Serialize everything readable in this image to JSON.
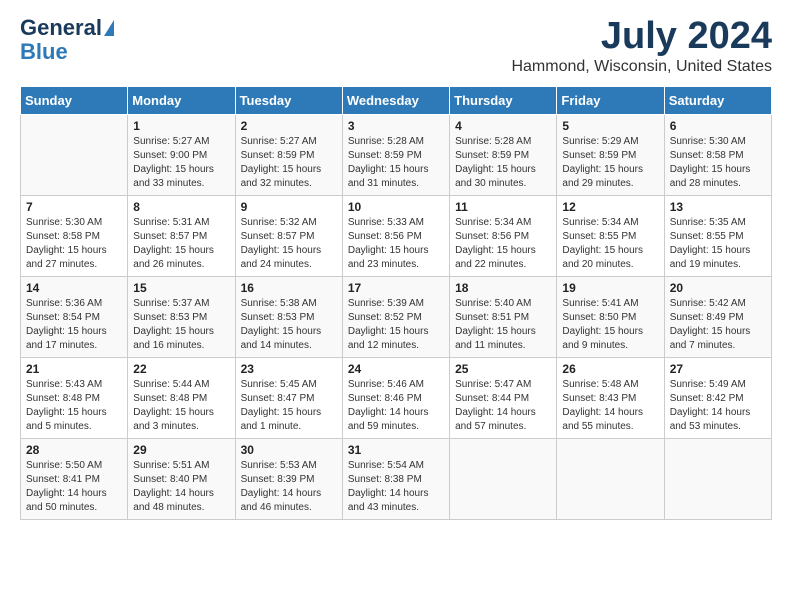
{
  "logo": {
    "line1": "General",
    "line2": "Blue"
  },
  "header": {
    "month_year": "July 2024",
    "location": "Hammond, Wisconsin, United States"
  },
  "days_of_week": [
    "Sunday",
    "Monday",
    "Tuesday",
    "Wednesday",
    "Thursday",
    "Friday",
    "Saturday"
  ],
  "weeks": [
    [
      {
        "day": "",
        "info": ""
      },
      {
        "day": "1",
        "info": "Sunrise: 5:27 AM\nSunset: 9:00 PM\nDaylight: 15 hours\nand 33 minutes."
      },
      {
        "day": "2",
        "info": "Sunrise: 5:27 AM\nSunset: 8:59 PM\nDaylight: 15 hours\nand 32 minutes."
      },
      {
        "day": "3",
        "info": "Sunrise: 5:28 AM\nSunset: 8:59 PM\nDaylight: 15 hours\nand 31 minutes."
      },
      {
        "day": "4",
        "info": "Sunrise: 5:28 AM\nSunset: 8:59 PM\nDaylight: 15 hours\nand 30 minutes."
      },
      {
        "day": "5",
        "info": "Sunrise: 5:29 AM\nSunset: 8:59 PM\nDaylight: 15 hours\nand 29 minutes."
      },
      {
        "day": "6",
        "info": "Sunrise: 5:30 AM\nSunset: 8:58 PM\nDaylight: 15 hours\nand 28 minutes."
      }
    ],
    [
      {
        "day": "7",
        "info": "Sunrise: 5:30 AM\nSunset: 8:58 PM\nDaylight: 15 hours\nand 27 minutes."
      },
      {
        "day": "8",
        "info": "Sunrise: 5:31 AM\nSunset: 8:57 PM\nDaylight: 15 hours\nand 26 minutes."
      },
      {
        "day": "9",
        "info": "Sunrise: 5:32 AM\nSunset: 8:57 PM\nDaylight: 15 hours\nand 24 minutes."
      },
      {
        "day": "10",
        "info": "Sunrise: 5:33 AM\nSunset: 8:56 PM\nDaylight: 15 hours\nand 23 minutes."
      },
      {
        "day": "11",
        "info": "Sunrise: 5:34 AM\nSunset: 8:56 PM\nDaylight: 15 hours\nand 22 minutes."
      },
      {
        "day": "12",
        "info": "Sunrise: 5:34 AM\nSunset: 8:55 PM\nDaylight: 15 hours\nand 20 minutes."
      },
      {
        "day": "13",
        "info": "Sunrise: 5:35 AM\nSunset: 8:55 PM\nDaylight: 15 hours\nand 19 minutes."
      }
    ],
    [
      {
        "day": "14",
        "info": "Sunrise: 5:36 AM\nSunset: 8:54 PM\nDaylight: 15 hours\nand 17 minutes."
      },
      {
        "day": "15",
        "info": "Sunrise: 5:37 AM\nSunset: 8:53 PM\nDaylight: 15 hours\nand 16 minutes."
      },
      {
        "day": "16",
        "info": "Sunrise: 5:38 AM\nSunset: 8:53 PM\nDaylight: 15 hours\nand 14 minutes."
      },
      {
        "day": "17",
        "info": "Sunrise: 5:39 AM\nSunset: 8:52 PM\nDaylight: 15 hours\nand 12 minutes."
      },
      {
        "day": "18",
        "info": "Sunrise: 5:40 AM\nSunset: 8:51 PM\nDaylight: 15 hours\nand 11 minutes."
      },
      {
        "day": "19",
        "info": "Sunrise: 5:41 AM\nSunset: 8:50 PM\nDaylight: 15 hours\nand 9 minutes."
      },
      {
        "day": "20",
        "info": "Sunrise: 5:42 AM\nSunset: 8:49 PM\nDaylight: 15 hours\nand 7 minutes."
      }
    ],
    [
      {
        "day": "21",
        "info": "Sunrise: 5:43 AM\nSunset: 8:48 PM\nDaylight: 15 hours\nand 5 minutes."
      },
      {
        "day": "22",
        "info": "Sunrise: 5:44 AM\nSunset: 8:48 PM\nDaylight: 15 hours\nand 3 minutes."
      },
      {
        "day": "23",
        "info": "Sunrise: 5:45 AM\nSunset: 8:47 PM\nDaylight: 15 hours\nand 1 minute."
      },
      {
        "day": "24",
        "info": "Sunrise: 5:46 AM\nSunset: 8:46 PM\nDaylight: 14 hours\nand 59 minutes."
      },
      {
        "day": "25",
        "info": "Sunrise: 5:47 AM\nSunset: 8:44 PM\nDaylight: 14 hours\nand 57 minutes."
      },
      {
        "day": "26",
        "info": "Sunrise: 5:48 AM\nSunset: 8:43 PM\nDaylight: 14 hours\nand 55 minutes."
      },
      {
        "day": "27",
        "info": "Sunrise: 5:49 AM\nSunset: 8:42 PM\nDaylight: 14 hours\nand 53 minutes."
      }
    ],
    [
      {
        "day": "28",
        "info": "Sunrise: 5:50 AM\nSunset: 8:41 PM\nDaylight: 14 hours\nand 50 minutes."
      },
      {
        "day": "29",
        "info": "Sunrise: 5:51 AM\nSunset: 8:40 PM\nDaylight: 14 hours\nand 48 minutes."
      },
      {
        "day": "30",
        "info": "Sunrise: 5:53 AM\nSunset: 8:39 PM\nDaylight: 14 hours\nand 46 minutes."
      },
      {
        "day": "31",
        "info": "Sunrise: 5:54 AM\nSunset: 8:38 PM\nDaylight: 14 hours\nand 43 minutes."
      },
      {
        "day": "",
        "info": ""
      },
      {
        "day": "",
        "info": ""
      },
      {
        "day": "",
        "info": ""
      }
    ]
  ]
}
